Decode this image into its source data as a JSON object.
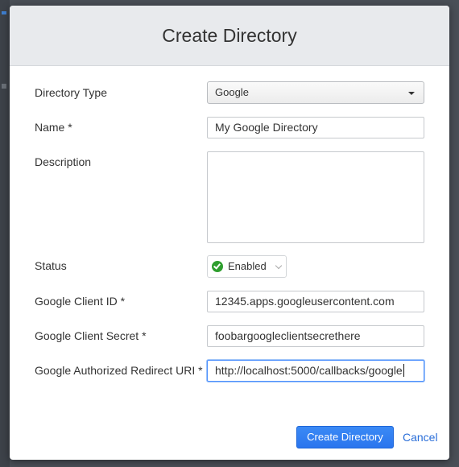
{
  "dialog": {
    "title": "Create Directory"
  },
  "form": {
    "directory_type": {
      "label": "Directory Type",
      "value": "Google"
    },
    "name": {
      "label": "Name *",
      "value": "My Google Directory"
    },
    "description": {
      "label": "Description",
      "value": ""
    },
    "status": {
      "label": "Status",
      "value": "Enabled"
    },
    "client_id": {
      "label": "Google Client ID *",
      "value": "12345.apps.googleusercontent.com"
    },
    "client_secret": {
      "label": "Google Client Secret *",
      "value": "foobargoogleclientsecrethere"
    },
    "redirect_uri": {
      "label": "Google Authorized Redirect URI *",
      "value": "http://localhost:5000/callbacks/google"
    }
  },
  "actions": {
    "submit_label": "Create Directory",
    "cancel_label": "Cancel"
  },
  "colors": {
    "primary": "#2a75ee",
    "link": "#2a6ed8",
    "status_ok": "#2e9e2e",
    "header_bg": "#e8eaed"
  },
  "icons": {
    "status": "check-circle-icon",
    "select": "caret-down-icon"
  }
}
